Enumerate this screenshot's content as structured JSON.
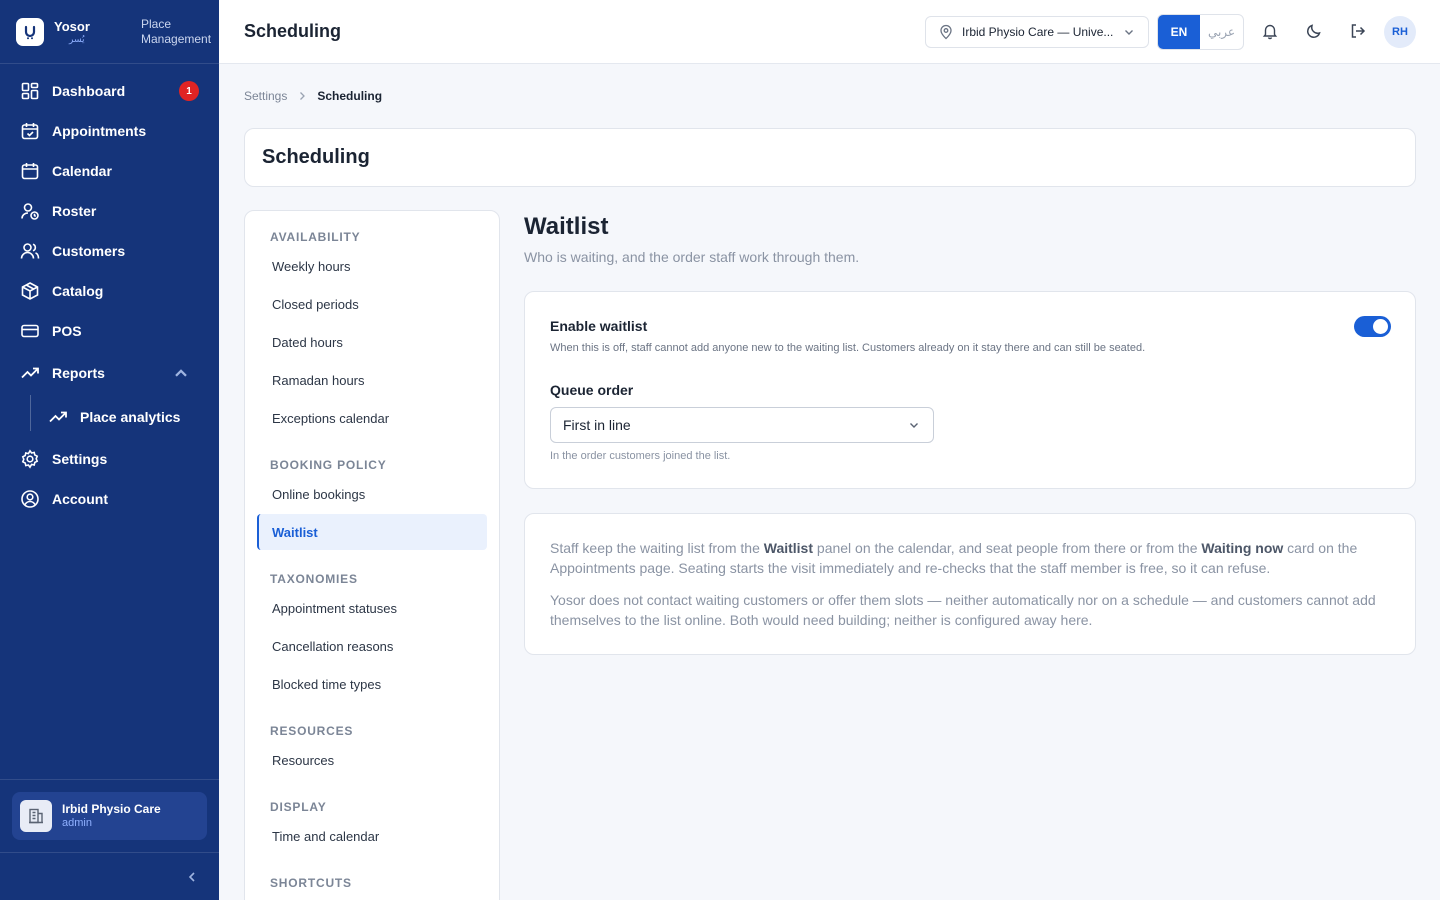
{
  "brand": {
    "name": "Yosor",
    "name_ar": "يُسر",
    "subtitle_line1": "Place",
    "subtitle_line2": "Management"
  },
  "sidebar": {
    "items": [
      {
        "label": "Dashboard",
        "badge": "1"
      },
      {
        "label": "Appointments"
      },
      {
        "label": "Calendar"
      },
      {
        "label": "Roster"
      },
      {
        "label": "Customers"
      },
      {
        "label": "Catalog"
      },
      {
        "label": "POS"
      },
      {
        "label": "Reports"
      },
      {
        "label": "Place analytics"
      },
      {
        "label": "Settings"
      },
      {
        "label": "Account"
      }
    ],
    "org": {
      "name": "Irbid Physio Care",
      "role": "admin"
    }
  },
  "topbar": {
    "title": "Scheduling",
    "location": "Irbid Physio Care — Unive...",
    "lang_en": "EN",
    "lang_ar": "عربي",
    "avatar_initials": "RH"
  },
  "breadcrumb": {
    "parent": "Settings",
    "current": "Scheduling"
  },
  "page": {
    "title": "Scheduling"
  },
  "subnav": {
    "groups": [
      {
        "heading": "AVAILABILITY",
        "items": [
          "Weekly hours",
          "Closed periods",
          "Dated hours",
          "Ramadan hours",
          "Exceptions calendar"
        ]
      },
      {
        "heading": "BOOKING POLICY",
        "items": [
          "Online bookings",
          "Waitlist"
        ]
      },
      {
        "heading": "TAXONOMIES",
        "items": [
          "Appointment statuses",
          "Cancellation reasons",
          "Blocked time types"
        ]
      },
      {
        "heading": "RESOURCES",
        "items": [
          "Resources"
        ]
      },
      {
        "heading": "DISPLAY",
        "items": [
          "Time and calendar"
        ]
      },
      {
        "heading": "SHORTCUTS",
        "items": []
      }
    ],
    "active": "Waitlist"
  },
  "section": {
    "title": "Waitlist",
    "description": "Who is waiting, and the order staff work through them."
  },
  "settings": {
    "enable_label": "Enable waitlist",
    "enable_help": "When this is off, staff cannot add anyone new to the waiting list. Customers already on it stay there and can still be seated.",
    "enabled": true,
    "queue_label": "Queue order",
    "queue_value": "First in line",
    "queue_help": "In the order customers joined the list."
  },
  "info": {
    "p1_a": "Staff keep the waiting list from the ",
    "p1_b": "Waitlist",
    "p1_c": " panel on the calendar, and seat people from there or from the ",
    "p1_d": "Waiting now",
    "p1_e": " card on the Appointments page. Seating starts the visit immediately and re-checks that the staff member is free, so it can refuse.",
    "p2": "Yosor does not contact waiting customers or offer them slots — neither automatically nor on a schedule — and customers cannot add themselves to the list online. Both would need building; neither is configured away here."
  },
  "colors": {
    "sidebar": "#15347a",
    "accent": "#1a5fd6",
    "badge": "#e02424"
  }
}
